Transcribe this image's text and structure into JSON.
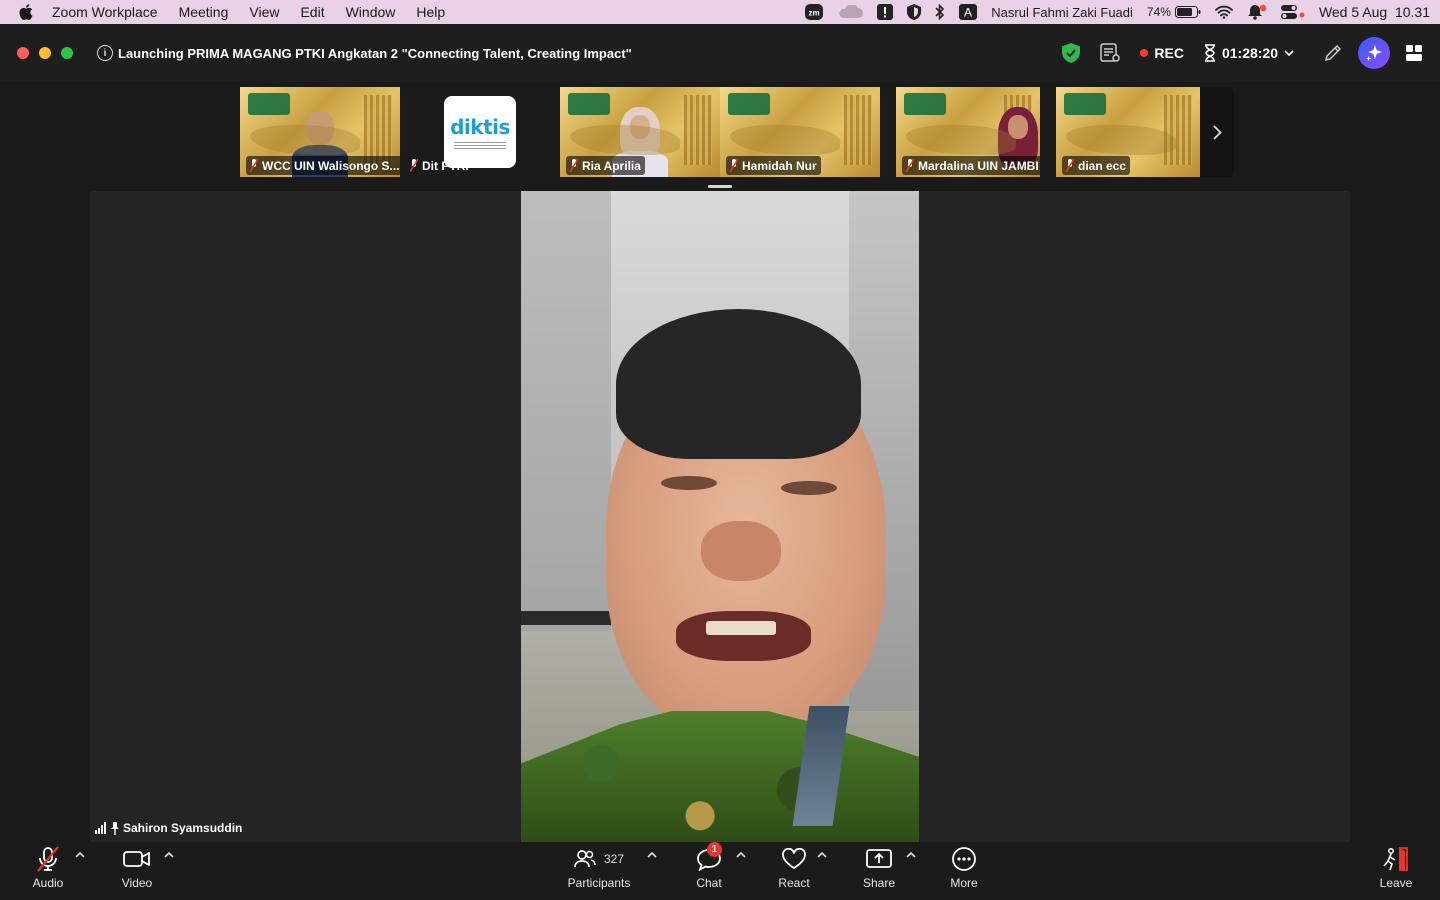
{
  "menubar": {
    "app_name": "Zoom Workplace",
    "menus": [
      "Meeting",
      "View",
      "Edit",
      "Window",
      "Help"
    ],
    "user_name": "Nasrul Fahmi Zaki Fuadi",
    "battery": "74%",
    "datetime": "Wed 5 Aug  10.31",
    "keyboard_input": "A",
    "zoom_badge": "zm",
    "icons": [
      "apple-icon",
      "zoom-icon",
      "cloud-icon",
      "alert-icon",
      "shield-icon",
      "bluetooth-icon",
      "input-source-icon",
      "battery-icon",
      "wifi-icon",
      "notification-bell-icon",
      "control-center-icon"
    ]
  },
  "window": {
    "meeting_title": "Launching PRIMA MAGANG PTKI Angkatan 2 \"Connecting Talent, Creating Impact\"",
    "rec_label": "REC",
    "timer": "01:28:20",
    "colors": {
      "security_shield": "#2fb84f",
      "rec_dot": "#ff3b30",
      "ai_button": "#4a55ff"
    }
  },
  "gallery": {
    "tiles": [
      {
        "name": "WCC UIN Walisongo S..."
      },
      {
        "name": "Dit PTKI",
        "logo_text": "diktis"
      },
      {
        "name": "Ria Aprilia"
      },
      {
        "name": "Hamidah Nur"
      },
      {
        "name": "Mardalina UIN JAMBI"
      },
      {
        "name": "dian ecc"
      }
    ]
  },
  "active_speaker": {
    "name": "Sahiron Syamsuddin"
  },
  "toolbar": {
    "audio": "Audio",
    "video": "Video",
    "participants": "Participants",
    "participants_count": "327",
    "chat": "Chat",
    "chat_badge": "1",
    "react": "React",
    "share": "Share",
    "more": "More",
    "leave": "Leave"
  }
}
